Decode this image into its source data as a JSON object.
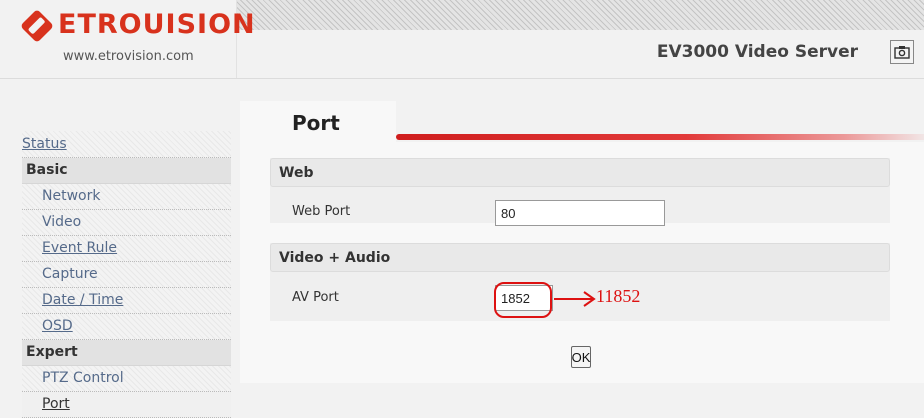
{
  "header": {
    "logo_text": "ETROUISION",
    "logo_url": "www.etrovision.com",
    "server_title": "EV3000 Video Server",
    "snapshot_icon": "camera-icon",
    "brand_color": "#d8321d"
  },
  "sidebar": {
    "status": "Status",
    "basic": "Basic",
    "network": "Network",
    "video": "Video",
    "event_rule": "Event Rule",
    "capture": "Capture",
    "date_time": "Date / Time",
    "osd": "OSD",
    "expert": "Expert",
    "ptz_control": "PTZ Control",
    "port": "Port"
  },
  "page": {
    "title": "Port",
    "accent_color": "#cf1d1d"
  },
  "web": {
    "heading": "Web",
    "web_port_label": "Web Port",
    "web_port_value": "80"
  },
  "video_audio": {
    "heading": "Video + Audio",
    "av_port_label": "AV Port",
    "av_port_value": "1852",
    "annotation": "11852",
    "annotation_color": "#d11111"
  },
  "actions": {
    "ok_label": "OK"
  }
}
